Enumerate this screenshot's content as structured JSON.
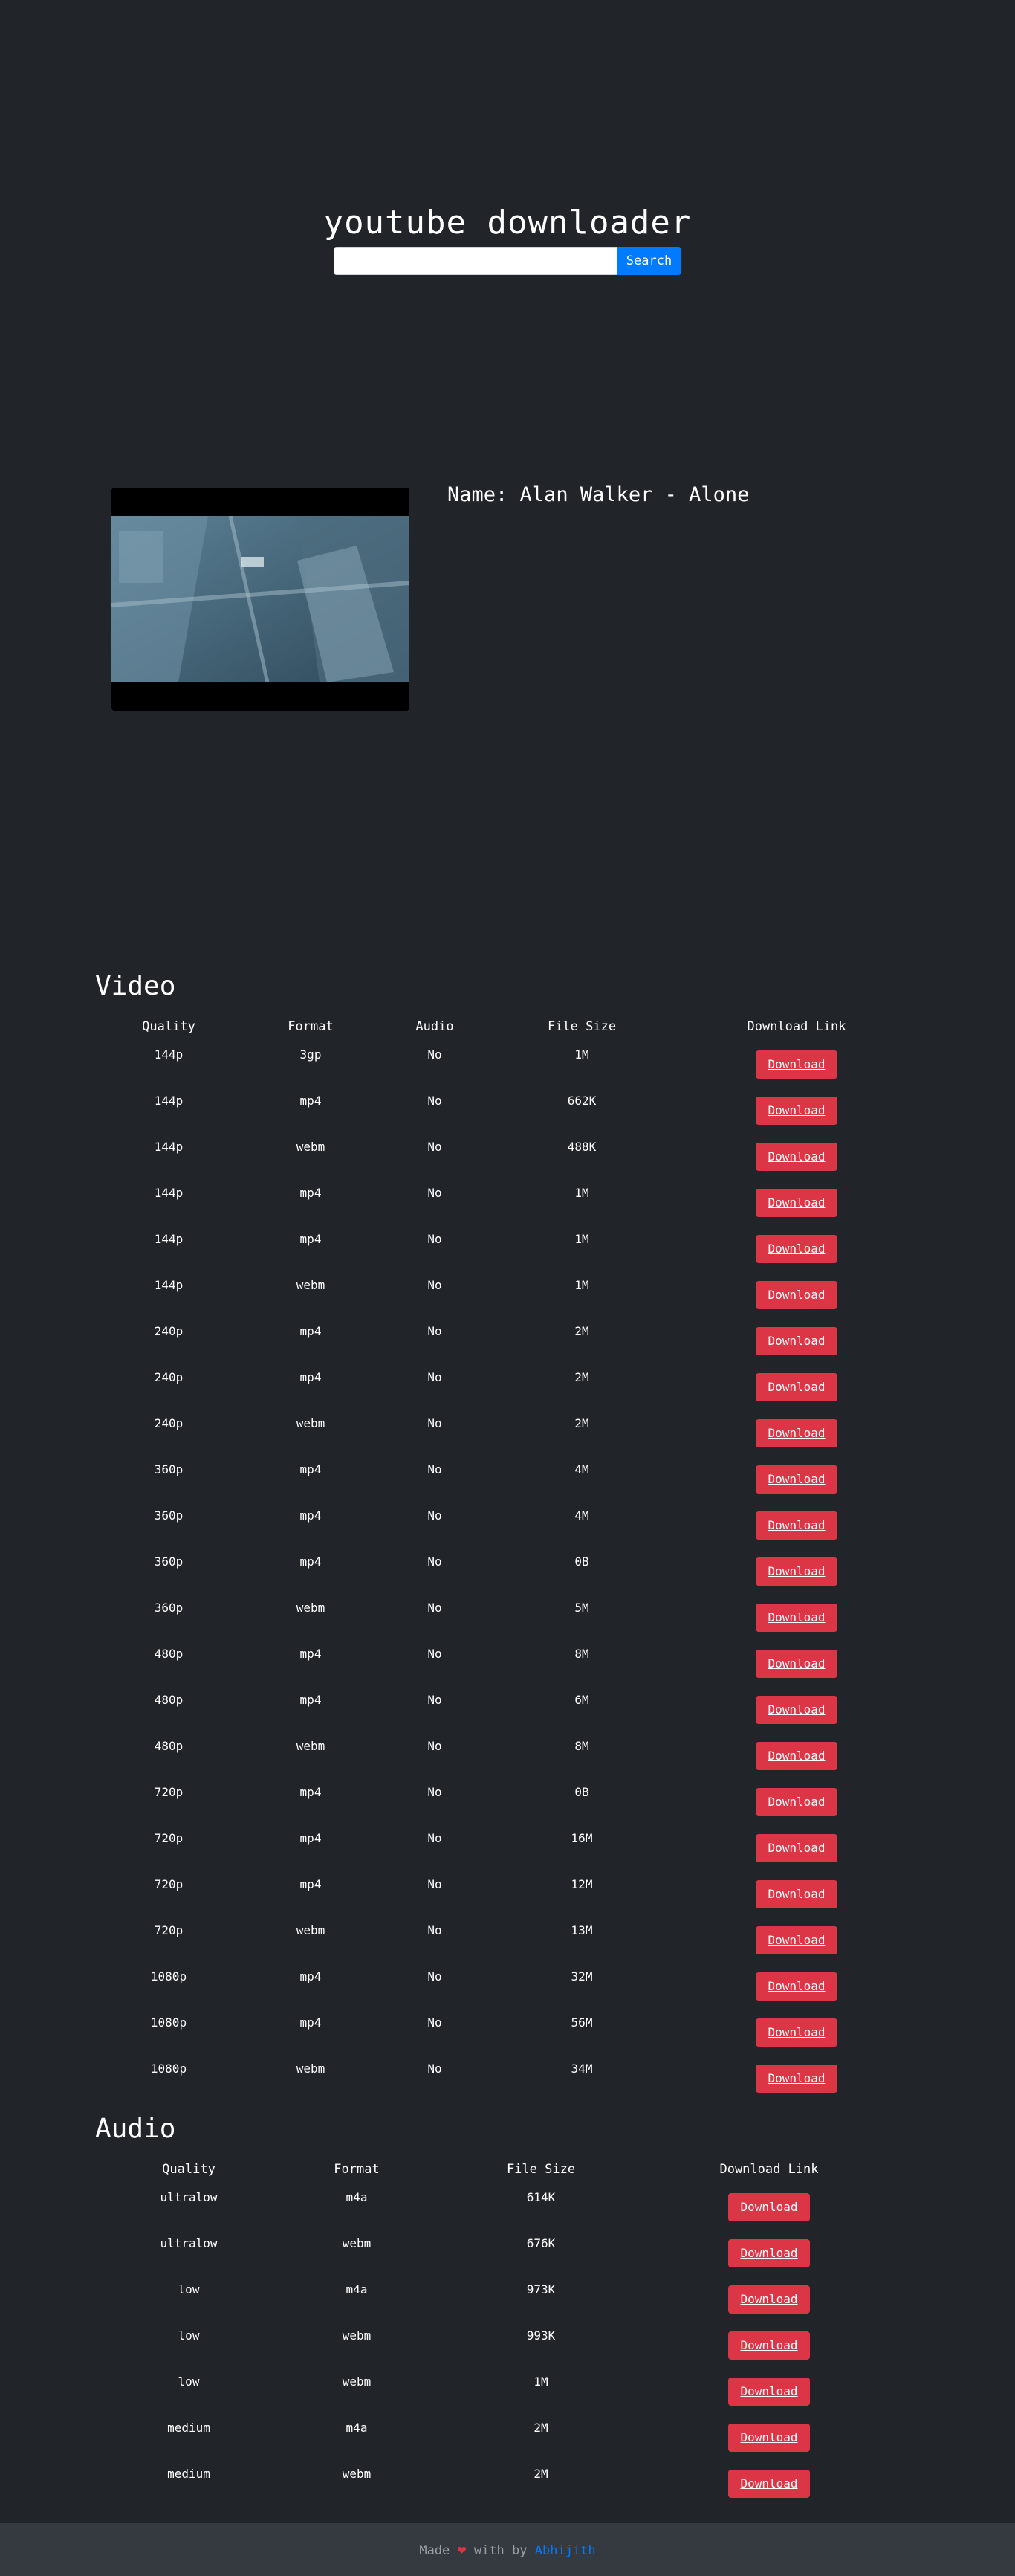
{
  "app": {
    "title": "youtube downloader"
  },
  "search": {
    "placeholder": "",
    "value": "",
    "button_label": "Search"
  },
  "video": {
    "name_label": "Name:",
    "name": "Alan Walker - Alone"
  },
  "video_section": {
    "title": "Video",
    "headers": [
      "Quality",
      "Format",
      "Audio",
      "File Size",
      "Download Link"
    ],
    "rows": [
      [
        "144p",
        "3gp",
        "No",
        "1M"
      ],
      [
        "144p",
        "mp4",
        "No",
        "662K"
      ],
      [
        "144p",
        "webm",
        "No",
        "488K"
      ],
      [
        "144p",
        "mp4",
        "No",
        "1M"
      ],
      [
        "144p",
        "mp4",
        "No",
        "1M"
      ],
      [
        "144p",
        "webm",
        "No",
        "1M"
      ],
      [
        "240p",
        "mp4",
        "No",
        "2M"
      ],
      [
        "240p",
        "mp4",
        "No",
        "2M"
      ],
      [
        "240p",
        "webm",
        "No",
        "2M"
      ],
      [
        "360p",
        "mp4",
        "No",
        "4M"
      ],
      [
        "360p",
        "mp4",
        "No",
        "4M"
      ],
      [
        "360p",
        "mp4",
        "No",
        "0B"
      ],
      [
        "360p",
        "webm",
        "No",
        "5M"
      ],
      [
        "480p",
        "mp4",
        "No",
        "8M"
      ],
      [
        "480p",
        "mp4",
        "No",
        "6M"
      ],
      [
        "480p",
        "webm",
        "No",
        "8M"
      ],
      [
        "720p",
        "mp4",
        "No",
        "0B"
      ],
      [
        "720p",
        "mp4",
        "No",
        "16M"
      ],
      [
        "720p",
        "mp4",
        "No",
        "12M"
      ],
      [
        "720p",
        "webm",
        "No",
        "13M"
      ],
      [
        "1080p",
        "mp4",
        "No",
        "32M"
      ],
      [
        "1080p",
        "mp4",
        "No",
        "56M"
      ],
      [
        "1080p",
        "webm",
        "No",
        "34M"
      ]
    ],
    "button_label": "Download"
  },
  "audio_section": {
    "title": "Audio",
    "headers": [
      "Quality",
      "Format",
      "File Size",
      "Download Link"
    ],
    "rows": [
      [
        "ultralow",
        "m4a",
        "614K"
      ],
      [
        "ultralow",
        "webm",
        "676K"
      ],
      [
        "low",
        "m4a",
        "973K"
      ],
      [
        "low",
        "webm",
        "993K"
      ],
      [
        "low",
        "webm",
        "1M"
      ],
      [
        "medium",
        "m4a",
        "2M"
      ],
      [
        "medium",
        "webm",
        "2M"
      ]
    ],
    "button_label": "Download"
  },
  "footer": {
    "made": "Made",
    "heart_icon": "heart-icon",
    "with_by": "with by",
    "author": "Abhijith"
  },
  "colors": {
    "background": "#212529",
    "primary": "#007bff",
    "danger": "#dc3545",
    "footer": "#343a40"
  }
}
